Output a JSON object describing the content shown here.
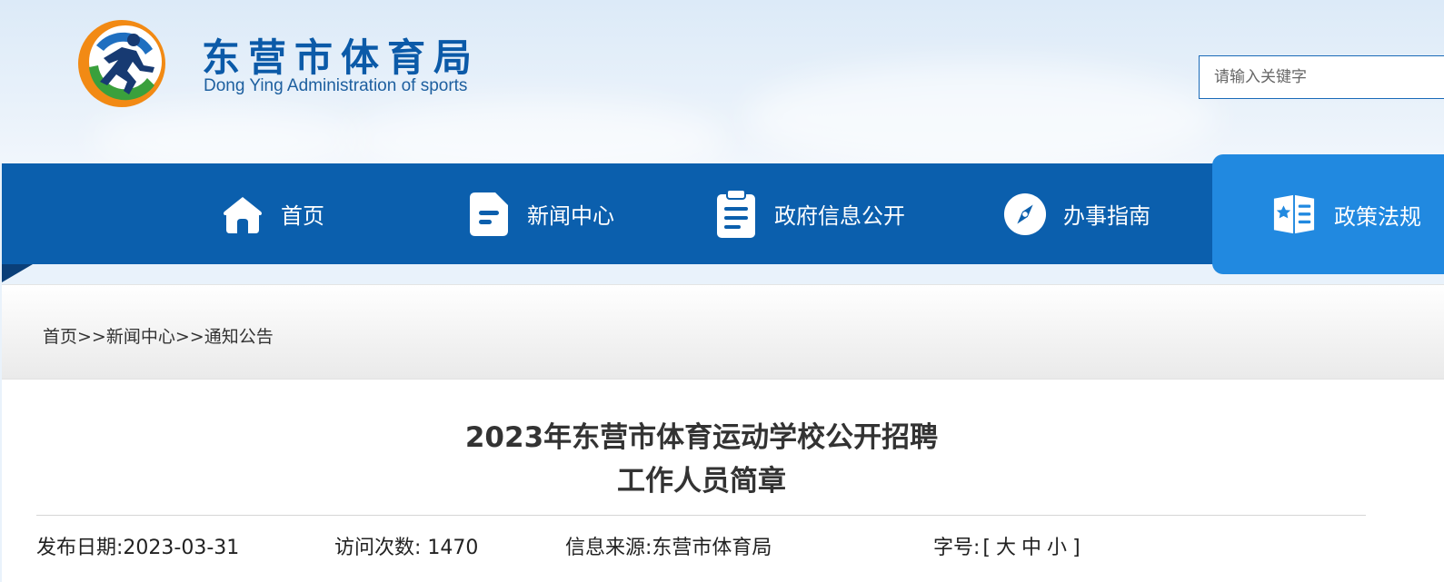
{
  "site": {
    "title": "东营市体育局",
    "subtitle": "Dong Ying Administration of sports"
  },
  "search": {
    "placeholder": "请输入关键字"
  },
  "nav": {
    "items": [
      {
        "label": "首页",
        "icon": "home-icon"
      },
      {
        "label": "新闻中心",
        "icon": "news-icon"
      },
      {
        "label": "政府信息公开",
        "icon": "clipboard-icon"
      },
      {
        "label": "办事指南",
        "icon": "compass-icon"
      },
      {
        "label": "政策法规",
        "icon": "policy-book-icon"
      }
    ],
    "active_index": 4
  },
  "breadcrumb": {
    "items": [
      "首页",
      "新闻中心",
      "通知公告"
    ],
    "separator": ">>"
  },
  "article": {
    "title_line1": "2023年东营市体育运动学校公开招聘",
    "title_line2": "工作人员简章",
    "publish_label": "发布日期:",
    "publish_date": "2023-03-31",
    "visits_label": "访问次数:",
    "visits": "1470",
    "source_label": "信息来源:",
    "source": "东营市体育局",
    "font_label": "字号:",
    "font_open": "[",
    "font_large": "大",
    "font_medium": "中",
    "font_small": "小",
    "font_close": "]"
  },
  "colors": {
    "nav_bg": "#0b5fad",
    "nav_active": "#2189e0",
    "title_blue": "#0b5aa8"
  }
}
